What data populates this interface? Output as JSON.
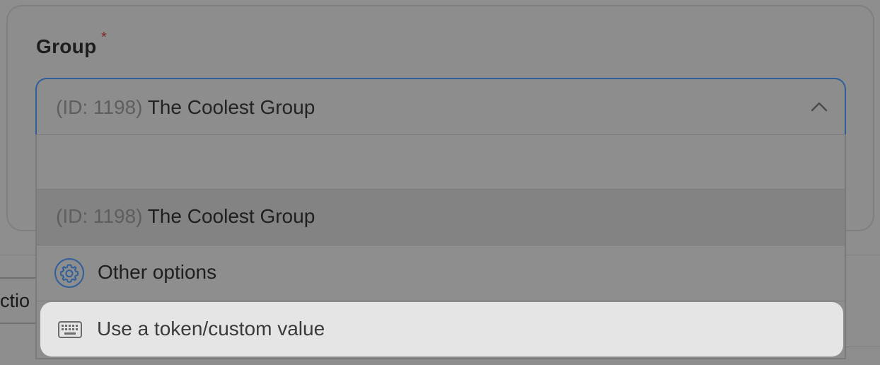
{
  "field": {
    "label": "Group",
    "required_mark": "*"
  },
  "select": {
    "selected_id_prefix": "(ID: 1198)",
    "selected_name": "The Coolest Group",
    "search_placeholder": ""
  },
  "options": [
    {
      "id_prefix": "(ID: 1198)",
      "name": "The Coolest Group"
    }
  ],
  "other_options_label": "Other options",
  "token_option_label": "Use a token/custom value",
  "background": {
    "partial_text": "ctio"
  },
  "icons": {
    "chevron": "chevron-up-icon",
    "gear": "gear-icon",
    "keyboard": "keyboard-icon"
  },
  "colors": {
    "accent": "#2f5f9a",
    "required": "#8a2a26",
    "highlight": "#e5e5e5"
  }
}
